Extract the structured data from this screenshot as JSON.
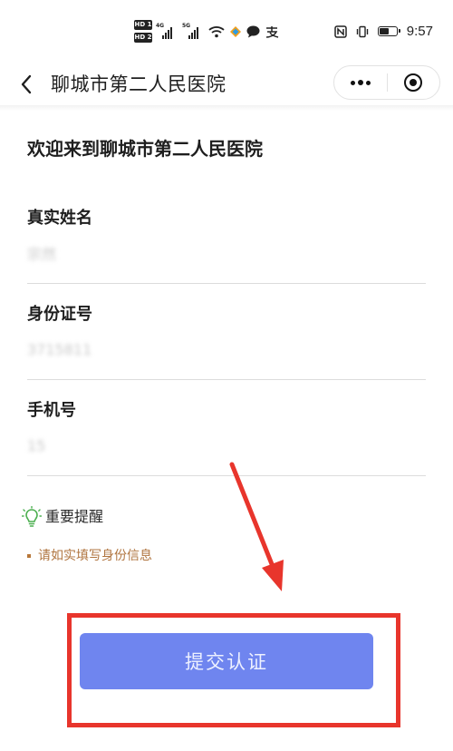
{
  "status_bar": {
    "hd_badges": [
      "HD 1",
      "HD 2"
    ],
    "network_1": "4G",
    "network_2": "5G",
    "battery_level": 0.6,
    "time": "9:57"
  },
  "nav": {
    "title": "聊城市第二人民医院",
    "back_icon": "chevron-left-icon",
    "menu_icon": "more-dots-icon",
    "close_icon": "target-circle-icon"
  },
  "form": {
    "welcome": "欢迎来到聊城市第二人民医院",
    "name_label": "真实姓名",
    "name_value": "宗然",
    "id_label": "身份证号",
    "id_value": "3715811",
    "phone_label": "手机号",
    "phone_value": "15"
  },
  "tip": {
    "icon": "lightbulb-icon",
    "title": "重要提醒",
    "detail": "请如实填写身份信息"
  },
  "submit": {
    "label": "提交认证"
  },
  "colors": {
    "button_bg": "#6f85ef",
    "tip_text": "#b07540",
    "annotation_red": "#e8352c",
    "lightbulb_green": "#4caf50"
  }
}
